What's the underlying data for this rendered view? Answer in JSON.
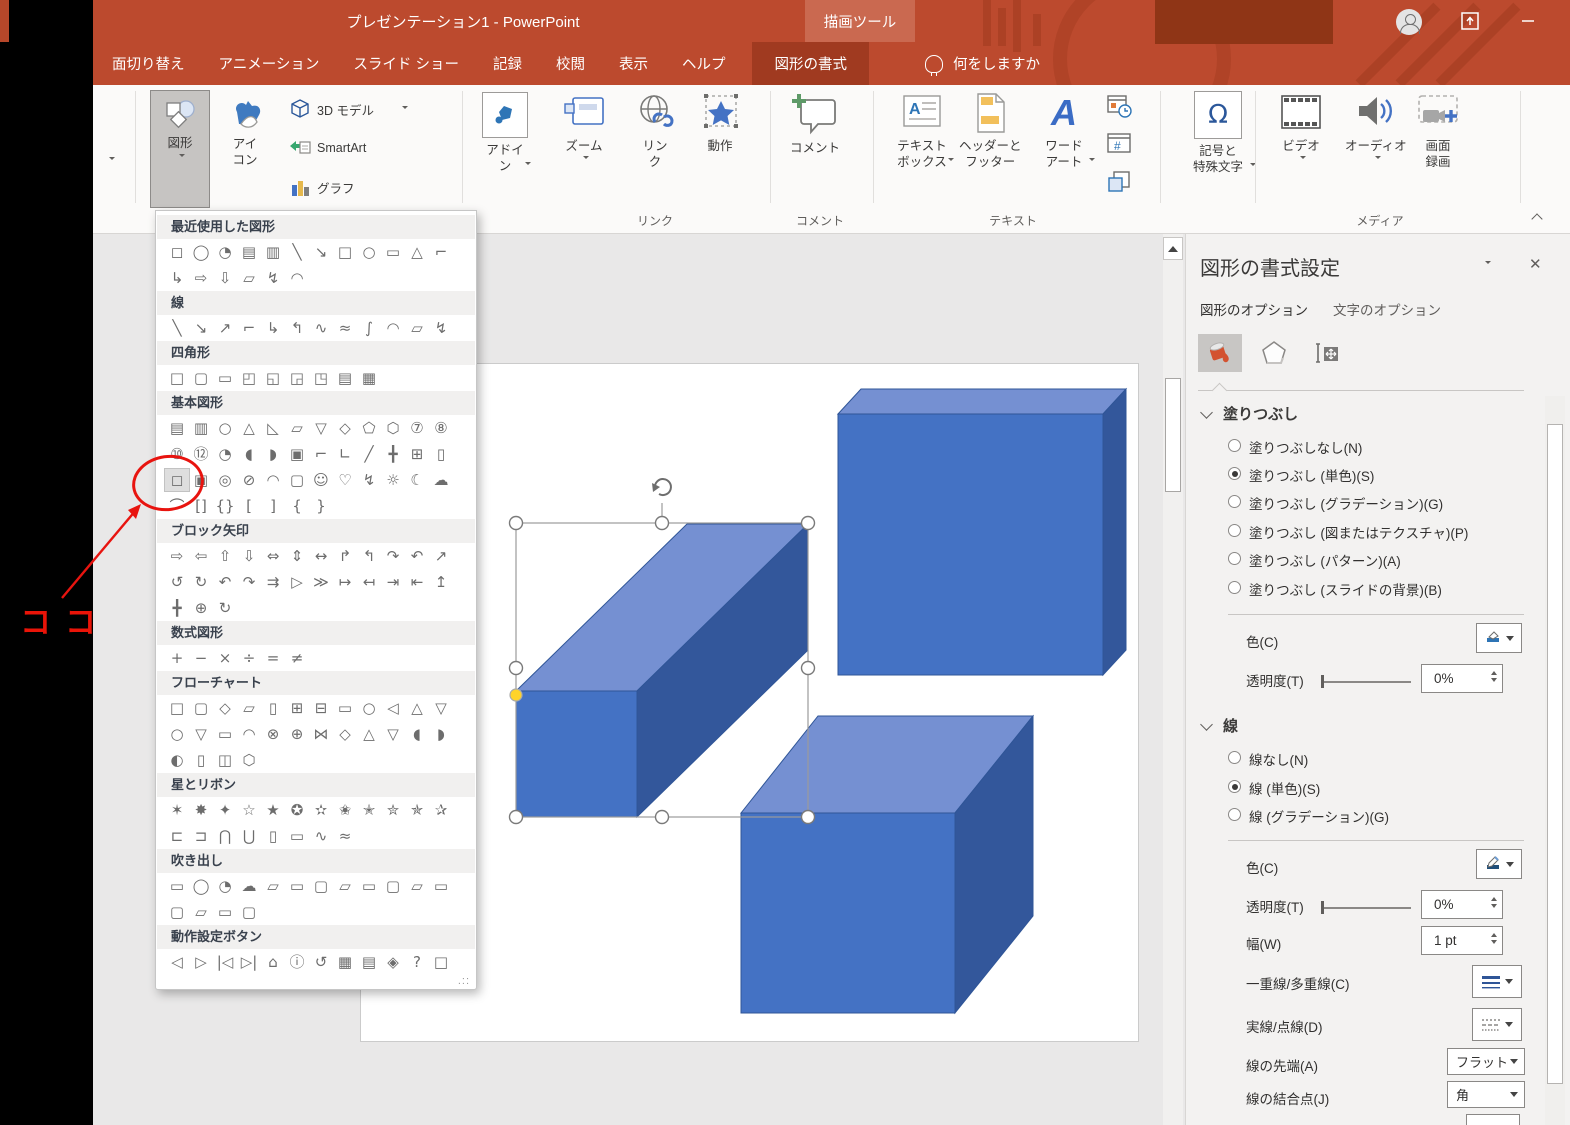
{
  "window": {
    "title": "プレゼンテーション1  -  PowerPoint",
    "context_title": "描画ツール",
    "tell_me": "何をしますか"
  },
  "tabs": {
    "items": [
      "面切り替え",
      "アニメーション",
      "スライド ショー",
      "記録",
      "校閲",
      "表示",
      "ヘルプ",
      "図形の書式"
    ],
    "active": "図形の書式"
  },
  "ribbon": {
    "shapes": "図形",
    "icons": "アイ\nコン",
    "model3d": "3D モデル",
    "smartart": "SmartArt",
    "chart": "グラフ",
    "addin": "アドイ\nン",
    "zoom": "ズーム",
    "link": "リン\nク",
    "action": "動作",
    "comment": "コメント",
    "textbox": "テキスト\nボックス",
    "headerfooter": "ヘッダーと\nフッター",
    "wordart": "ワード\nアート",
    "symbol": "記号と\n特殊文字",
    "video": "ビデオ",
    "audio": "オーディオ",
    "screenrec": "画面\n録画",
    "groups": [
      "リンク",
      "コメント",
      "テキスト",
      "メディア"
    ]
  },
  "shapes_menu": {
    "highlight": {
      "section": 3,
      "row": 2,
      "col": 0
    },
    "sections": [
      {
        "title": "最近使用した図形",
        "rows": [
          [
            "◻",
            "◯",
            "◔",
            "▤",
            "▥",
            "╲",
            "↘",
            "□",
            "○",
            "▭",
            "△",
            "⌐"
          ],
          [
            "↳",
            "⇨",
            "⇩",
            "▱",
            "↯",
            "◠"
          ]
        ]
      },
      {
        "title": "線",
        "rows": [
          [
            "╲",
            "↘",
            "↗",
            "⌐",
            "↳",
            "↰",
            "∿",
            "≈",
            "∫",
            "◠",
            "▱",
            "↯"
          ]
        ]
      },
      {
        "title": "四角形",
        "rows": [
          [
            "□",
            "▢",
            "▭",
            "◰",
            "◱",
            "◲",
            "◳",
            "▤",
            "▦"
          ]
        ]
      },
      {
        "title": "基本図形",
        "rows": [
          [
            "▤",
            "▥",
            "○",
            "△",
            "◺",
            "▱",
            "▽",
            "◇",
            "⬠",
            "⬡",
            "⑦",
            "⑧"
          ],
          [
            "⑩",
            "⑫",
            "◔",
            "◖",
            "◗",
            "▣",
            "⌐",
            "∟",
            "╱",
            "╋",
            "⊞",
            "▯"
          ],
          [
            "◻",
            "▣",
            "◎",
            "⊘",
            "◠",
            "▢",
            "☺",
            "♡",
            "↯",
            "☼",
            "☾",
            "☁"
          ],
          [
            "⌒",
            "[]",
            "{}",
            "[",
            "]",
            "{",
            "}"
          ]
        ]
      },
      {
        "title": "ブロック矢印",
        "rows": [
          [
            "⇨",
            "⇦",
            "⇧",
            "⇩",
            "⇔",
            "⇕",
            "↔",
            "↱",
            "↰",
            "↷",
            "↶",
            "↗"
          ],
          [
            "↺",
            "↻",
            "↶",
            "↷",
            "⇉",
            "▷",
            "≫",
            "↦",
            "↤",
            "⇥",
            "⇤",
            "↥"
          ],
          [
            "╋",
            "⊕",
            "↻"
          ]
        ]
      },
      {
        "title": "数式図形",
        "rows": [
          [
            "+",
            "−",
            "×",
            "÷",
            "=",
            "≠"
          ]
        ]
      },
      {
        "title": "フローチャート",
        "rows": [
          [
            "□",
            "▢",
            "◇",
            "▱",
            "▯",
            "⊞",
            "⊟",
            "▭",
            "○",
            "◁",
            "△",
            "▽"
          ],
          [
            "○",
            "▽",
            "▭",
            "◠",
            "⊗",
            "⊕",
            "⋈",
            "◇",
            "△",
            "▽",
            "◖",
            "◗"
          ],
          [
            "◐",
            "▯",
            "◫",
            "⬡"
          ]
        ]
      },
      {
        "title": "星とリボン",
        "rows": [
          [
            "✶",
            "✸",
            "✦",
            "☆",
            "★",
            "✪",
            "✫",
            "✬",
            "✭",
            "✮",
            "✯",
            "✰"
          ],
          [
            "⊏",
            "⊐",
            "⋂",
            "⋃",
            "▯",
            "▭",
            "∿",
            "≈"
          ]
        ]
      },
      {
        "title": "吹き出し",
        "rows": [
          [
            "▭",
            "◯",
            "◔",
            "☁",
            "▱",
            "▭",
            "▢",
            "▱",
            "▭",
            "▢",
            "▱",
            "▭"
          ],
          [
            "▢",
            "▱",
            "▭",
            "▢"
          ]
        ]
      },
      {
        "title": "動作設定ボタン",
        "rows": [
          [
            "◁",
            "▷",
            "|◁",
            "▷|",
            "⌂",
            "ⓘ",
            "↺",
            "▦",
            "▤",
            "◈",
            "?",
            "□"
          ]
        ]
      }
    ]
  },
  "annotation": {
    "text": "ココ"
  },
  "canvas": {
    "cube_colors": {
      "top": "#7590d2",
      "front": "#4472c4",
      "side": "#33579b",
      "stroke": "#2f5597"
    }
  },
  "format_panel": {
    "title": "図形の書式設定",
    "tab_shape": "図形のオプション",
    "tab_text": "文字のオプション",
    "fill": {
      "section": "塗りつぶし",
      "options": [
        {
          "label": "塗りつぶしなし(N)"
        },
        {
          "label": "塗りつぶし (単色)(S)"
        },
        {
          "label": "塗りつぶし (グラデーション)(G)"
        },
        {
          "label": "塗りつぶし (図またはテクスチャ)(P)"
        },
        {
          "label": "塗りつぶし (パターン)(A)"
        },
        {
          "label": "塗りつぶし (スライドの背景)(B)"
        }
      ],
      "color_label": "色(C)",
      "transparency_label": "透明度(T)",
      "transparency_value": "0%"
    },
    "line": {
      "section": "線",
      "options": [
        {
          "label": "線なし(N)"
        },
        {
          "label": "線 (単色)(S)"
        },
        {
          "label": "線 (グラデーション)(G)"
        }
      ],
      "color_label": "色(C)",
      "transparency_label": "透明度(T)",
      "transparency_value": "0%",
      "width_label": "幅(W)",
      "width_value": "1 pt",
      "compound_label": "一重線/多重線(C)",
      "dash_label": "実線/点線(D)",
      "cap_label": "線の先端(A)",
      "cap_value": "フラット",
      "join_label": "線の結合点(J)",
      "join_value": "角"
    }
  }
}
